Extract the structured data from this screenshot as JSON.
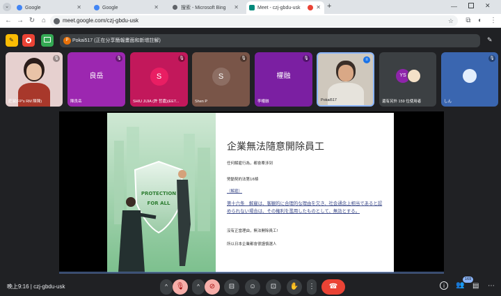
{
  "browser": {
    "tabs": [
      {
        "title": "Google",
        "active": false
      },
      {
        "title": "Google",
        "active": false
      },
      {
        "title": "搜索 - Microsoft Bing",
        "active": false
      },
      {
        "title": "Meet - czj-gbdu-usk",
        "active": true
      }
    ],
    "new_tab": "+",
    "url": "meet.google.com/czj-gbdu-usk"
  },
  "meet": {
    "presenter_initial": "P",
    "presenter_banner": "Pokai517 (正在分享簡報畫面和新增註解)",
    "participants": [
      {
        "name": "莊淑(FP's RM 陳陳)",
        "initial": "",
        "bg": "#e6d0cf"
      },
      {
        "name": "陳良岳",
        "initial": "良岳",
        "bg": "#9c27b0"
      },
      {
        "name": "SHIU JIJIA (許 哲嘉)(EET...",
        "initial": "S",
        "bg": "#c2185b"
      },
      {
        "name": "Shen P",
        "initial": "S",
        "bg": "#795548"
      },
      {
        "name": "李權融",
        "initial": "權融",
        "bg": "#7b1fa2"
      },
      {
        "name": "Pokai517",
        "initial": "",
        "bg": "#cfc8bd"
      },
      {
        "name": "還有另外 159 位使用者",
        "initial": "YS",
        "bg": "#3c4043"
      },
      {
        "name": "しん",
        "initial": "",
        "bg": "#3a66b0"
      }
    ],
    "slide": {
      "title": "企業無法隨意開除員工",
      "line1": "任何解雇行為，都會牽涉到",
      "line2": "勞動契約法第16條",
      "line3": "（解雇）",
      "article": "第十六条　解雇は、客観的に合理的な理由を欠き、社会通念上相当であると認められない場合は、その権利を濫用したものとして、無効とする。",
      "line4": "沒有正當理由，無法開除員工!",
      "line5": "所以日本企業都會很謹慎選人",
      "shield_text_1": "PROTECTION",
      "shield_text_2": "FOR ALL"
    },
    "bottom": {
      "time_code": "晚上9:16 | czj-gbdu-usk",
      "participant_count": "169"
    }
  },
  "colors": {
    "bg": "#202124",
    "end_call": "#ea4335",
    "muted_red": "#f6aea9"
  }
}
